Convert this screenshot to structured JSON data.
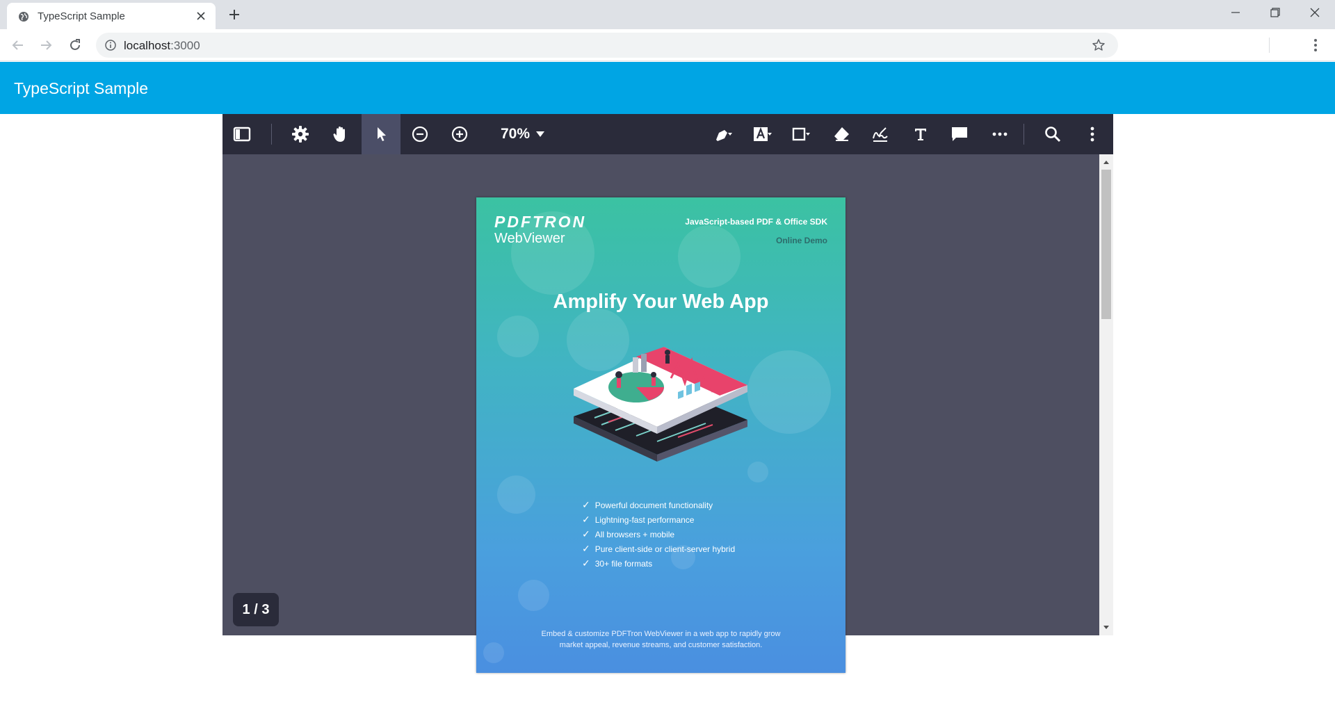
{
  "browser": {
    "tab_title": "TypeScript Sample",
    "url_host": "localhost",
    "url_port": ":3000"
  },
  "app": {
    "title": "TypeScript Sample"
  },
  "viewer": {
    "zoom_label": "70%",
    "page_indicator": "1 / 3",
    "tools": [
      "panel-toggle-icon",
      "settings-icon",
      "pan-hand-icon",
      "select-pointer-icon",
      "zoom-out-icon",
      "zoom-in-icon",
      "highlight-pen-icon",
      "text-box-icon",
      "rectangle-shape-icon",
      "eraser-icon",
      "signature-icon",
      "free-text-icon",
      "comment-bubble-icon",
      "more-horizontal-icon",
      "search-icon",
      "more-vertical-icon"
    ]
  },
  "document": {
    "brand": "PDFTRON",
    "product": "WebViewer",
    "tagline": "JavaScript-based PDF & Office SDK",
    "demo_label": "Online Demo",
    "headline": "Amplify Your Web App",
    "features": [
      "Powerful document functionality",
      "Lightning-fast performance",
      "All browsers + mobile",
      "Pure client-side or client-server hybrid",
      "30+ file formats"
    ],
    "footer_line1": "Embed & customize PDFTron WebViewer in a web app to rapidly grow",
    "footer_line2": "market appeal, revenue streams, and customer satisfaction."
  },
  "colors": {
    "app_header": "#00a5e4",
    "viewer_header": "#2a2b3a",
    "viewer_bg": "#4e4f61",
    "active_tool": "#4b4e67"
  }
}
